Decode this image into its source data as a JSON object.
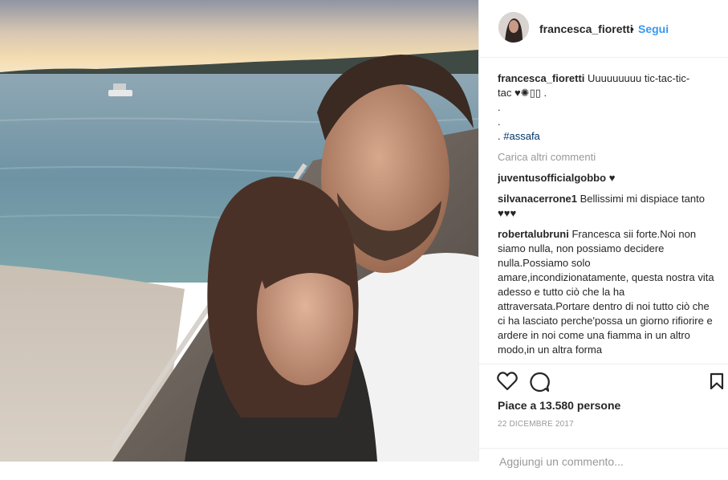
{
  "post": {
    "username": "francesca_fioretti",
    "separator": "•",
    "follow_label": "Segui"
  },
  "caption": {
    "username": "francesca_fioretti",
    "line1": "Uuuuuuuuu tic-tac-tic-",
    "line2": "tac ♥✺▯▯ .",
    "dot1": ".",
    "dot2": ".",
    "dot3": ".",
    "hashtag": "#assafa"
  },
  "load_more_label": "Carica altri commenti",
  "comments": [
    {
      "username": "juventusofficialgobbo",
      "text": "♥"
    },
    {
      "username": "silvanacerrone1",
      "text": "Bellissimi mi dispiace tanto ♥♥♥"
    },
    {
      "username": "robertalubruni",
      "text": "Francesca sii forte.Noi non siamo nulla, non possiamo decidere nulla.Possiamo solo amare,incondizionatamente, questa nostra vita adesso e tutto ciò che la ha attraversata.Portare dentro di noi tutto ciò che ci ha lasciato perche'possa un giorno rifiorire e ardere in noi come una fiamma in un altro modo,in un altra forma"
    }
  ],
  "likes_text": "Piace a 13.580 persone",
  "date_text": "22 DICEMBRE 2017",
  "add_comment_placeholder": "Aggiungi un commento..."
}
